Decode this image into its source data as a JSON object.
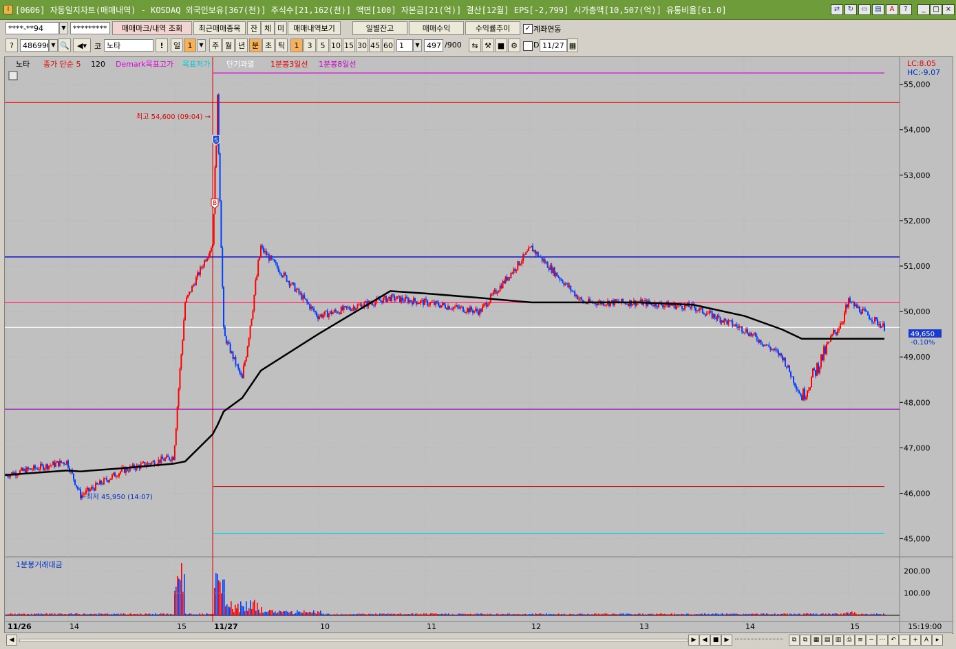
{
  "window": {
    "title": "[0606] 자동일지차트(매매내역) - KOSDAQ 외국인보유[367(천)] 주식수[21,162(천)] 액면[100] 자본금[21(억)] 결산[12월] EPS[-2,799] 시가총액[10,507(억)] 유통비율[61.0]",
    "icon_label": "I"
  },
  "toolbar1": {
    "account": "****-**94",
    "password": "*********",
    "btn_mark": "매매마크/내역 조회",
    "btn_recent": "최근매매종목",
    "btn_jan": "잔",
    "btn_che": "체",
    "btn_mi": "미",
    "btn_history": "매매내역보기",
    "btn_daily": "일별잔고",
    "btn_profit": "매매수익",
    "btn_rate": "수익률추이",
    "chk_account_link": "계좌연동"
  },
  "toolbar2": {
    "code": "486990",
    "stock_prefix": "코",
    "stock_name": "노타",
    "period_day": "일",
    "period_num": "1",
    "week": "주",
    "month": "월",
    "year": "년",
    "minute": "분",
    "second": "초",
    "tick": "틱",
    "intervals": [
      "1",
      "3",
      "5",
      "10",
      "15",
      "30",
      "45",
      "60"
    ],
    "interval_sel": "1",
    "count": "497",
    "count_total": "/900",
    "chk_d": "D",
    "date": "11/27"
  },
  "legend": {
    "stock": "노타",
    "ma_label": "종가 단순 5",
    "ma_120": "120",
    "demark": "Demark목표고가",
    "target": "목표저가",
    "overheat": "단기과열",
    "line3": "1분봉3일선",
    "line8": "1분봉8일선",
    "lc": "LC:8.05",
    "hc": "HC:-9.07"
  },
  "annotations": {
    "high": "최고 54,600 (09:04) →",
    "low": "←최저 45,950 (14:07)",
    "sell_mark": "S",
    "buy_mark": "B"
  },
  "price_axis": {
    "ticks": [
      "55,000",
      "54,000",
      "53,000",
      "52,000",
      "51,000",
      "50,000",
      "49,000",
      "48,000",
      "47,000",
      "46,000",
      "45,000"
    ],
    "current": "49,650",
    "change": "-0.10%"
  },
  "volume": {
    "title": "1분봉거래대금",
    "ticks": [
      "200.00",
      "100.00"
    ]
  },
  "time_axis": {
    "labels": [
      "11/26",
      "14",
      "15",
      "11/27",
      "10",
      "11",
      "12",
      "13",
      "14",
      "15"
    ],
    "clock": "15:19:00"
  },
  "chart_data": {
    "type": "line",
    "title": "",
    "xlabel": "",
    "ylabel": "",
    "ylim": [
      44600,
      55600
    ],
    "x": [
      "11/26 13:30",
      "11/26 14:00",
      "11/26 14:07",
      "11/26 14:30",
      "11/26 15:00",
      "11/26 15:20",
      "11/27 09:00",
      "11/27 09:04",
      "11/27 09:15",
      "11/27 09:25",
      "11/27 09:40",
      "11/27 10:00",
      "11/27 10:30",
      "11/27 11:00",
      "11/27 11:30",
      "11/27 12:00",
      "11/27 12:30",
      "11/27 13:00",
      "11/27 13:30",
      "11/27 14:00",
      "11/27 14:30",
      "11/27 14:45",
      "11/27 15:00",
      "11/27 15:19"
    ],
    "series": [
      {
        "name": "",
        "values": [
          46400,
          46700,
          45950,
          46500,
          46800,
          50200,
          51500,
          54600,
          49500,
          48500,
          51400,
          49900,
          50300,
          50200,
          50000,
          51400,
          50200,
          50200,
          50100,
          49600,
          49000,
          48100,
          50200,
          49650
        ]
      },
      {
        "name": "120",
        "values": [
          46400,
          46500,
          46480,
          46550,
          46650,
          46700,
          47300,
          47500,
          47800,
          48100,
          48700,
          49500,
          50450,
          50400,
          50300,
          50200,
          50200,
          50200,
          50150,
          49900,
          49600,
          49400,
          49400,
          49400
        ]
      }
    ],
    "levels": [
      {
        "name": "Demark목표고가",
        "value": 55250,
        "color": "#e000e0"
      },
      {
        "name": "",
        "value": 54600,
        "color": "#e00000"
      },
      {
        "name": "",
        "value": 51200,
        "color": "#0000e0"
      },
      {
        "name": "",
        "value": 50200,
        "color": "#ff2060"
      },
      {
        "name": "",
        "value": 49650,
        "color": "#ffffff"
      },
      {
        "name": "",
        "value": 47850,
        "color": "#a000c0"
      },
      {
        "name": "",
        "value": 46150,
        "color": "#e00000"
      },
      {
        "name": "목표저가",
        "value": 45120,
        "color": "#00c8d8"
      }
    ]
  },
  "colors": {
    "chart_bg": "#c0c0c0",
    "up": "#ff0000",
    "down": "#0040ff",
    "ma": "#000000",
    "titlebar": "#6f9c3a",
    "active_btn": "#f7b257"
  },
  "statusbar": {
    "btns": [
      "◀",
      "▶",
      "◀",
      "■",
      "▶"
    ]
  }
}
